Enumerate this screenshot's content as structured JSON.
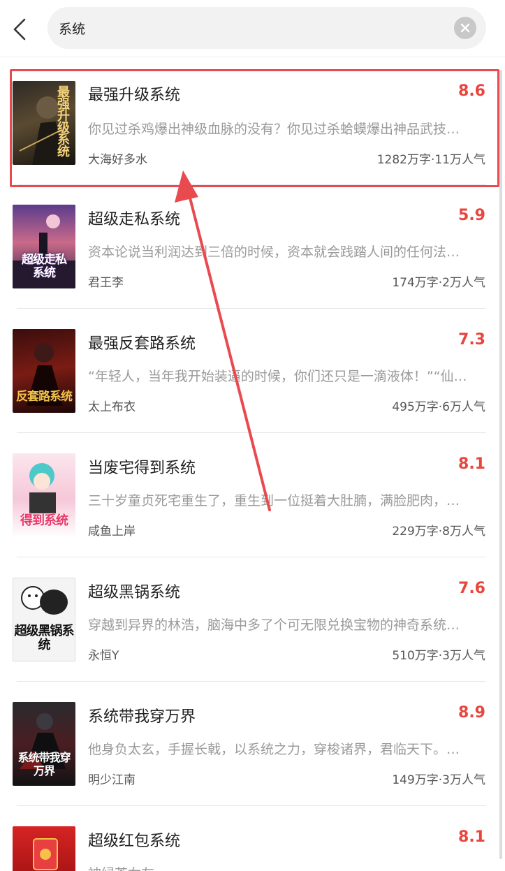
{
  "search": {
    "value": "系统",
    "back_icon": "chevron-left-icon",
    "clear_icon": "clear-icon"
  },
  "colors": {
    "score": "#e8453c",
    "highlight": "#e84a4f"
  },
  "books": [
    {
      "title": "最强升级系统",
      "score": "8.6",
      "desc": "你见过杀鸡爆出神级血脉的没有？你见过杀蛤蟆爆出神品武技…",
      "author": "大海好多水",
      "meta": "1282万字·11万人气",
      "cover_text": "最强升级系统"
    },
    {
      "title": "超级走私系统",
      "score": "5.9",
      "desc": "资本论说当利润达到三倍的时候，资本就会践踏人间的任何法…",
      "author": "君王李",
      "meta": "174万字·2万人气",
      "cover_text": "超级走私系统"
    },
    {
      "title": "最强反套路系统",
      "score": "7.3",
      "desc": "“年轻人，当年我开始装逼的时候，你们还只是一滴液体！”“仙…",
      "author": "太上布衣",
      "meta": "495万字·6万人气",
      "cover_text": "反套路系统"
    },
    {
      "title": "当废宅得到系统",
      "score": "8.1",
      "desc": "三十岁童贞死宅重生了，重生到一位挺着大肚腩，满脸肥肉，…",
      "author": "咸鱼上岸",
      "meta": "229万字·8万人气",
      "cover_text": "得到系统"
    },
    {
      "title": "超级黑锅系统",
      "score": "7.6",
      "desc": "穿越到异界的林浩，脑海中多了个可无限兑换宝物的神奇系统…",
      "author": "永恒Y",
      "meta": "510万字·3万人气",
      "cover_text": "超级黑锅系统"
    },
    {
      "title": "系统带我穿万界",
      "score": "8.9",
      "desc": "他身负太玄，手握长戟，以系统之力，穿梭诸界，君临天下。…",
      "author": "明少江南",
      "meta": "149万字·3万人气",
      "cover_text": "系统带我穿万界"
    },
    {
      "title": "超级红包系统",
      "score": "8.1",
      "desc": "被绿茶女友"
    },
    {
      "author": "",
      "meta": "",
      "cover_text": ""
    }
  ]
}
